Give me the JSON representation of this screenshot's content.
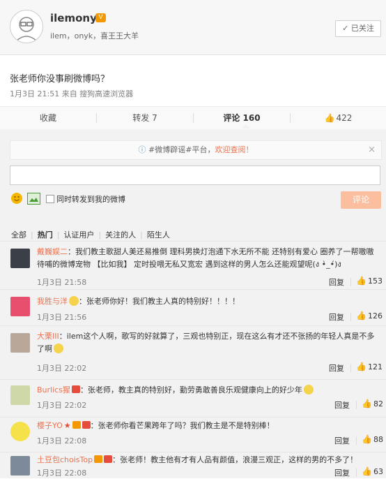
{
  "profile": {
    "username": "ilemonyk",
    "subtitle": "ilem，onyk，喜王王大羊",
    "follow_label": "已关注"
  },
  "post": {
    "text": "张老师你没事刷微博吗？",
    "meta": "1月3日 21:51 来自 搜狗高速浏览器"
  },
  "tabs": {
    "favorite": "收藏",
    "repost": "转发 7",
    "comment": "评论 160",
    "like": "422"
  },
  "compose": {
    "notice_prefix": "#微博辟谣#平台，",
    "notice_highlight": "欢迎查阅！",
    "notice_close": "×",
    "also_repost": "同时转发到我的微博",
    "submit": "评论"
  },
  "filters": {
    "all": "全部",
    "hot": "热门",
    "verified": "认证用户",
    "following": "关注的人",
    "strangers": "陌生人"
  },
  "comments": [
    {
      "name": "戴巍娱二",
      "text": "：我们教主歌甜人美还易推倒 理科男换灯泡通下水无所不能 还特别有爱心 圈养了一帮嗷嗷待哺的微博宠物 【比如我】 定时投喂无私又宽宏 遇到这样的男人怎么还能观望呢(ง •̀_•́)ง",
      "time": "1月3日 21:58",
      "reply": "回复",
      "likes": "153"
    },
    {
      "name": "我胜与洋",
      "text": "：张老师你好！我们教主人真的特别好！！！！",
      "time": "1月3日 21:56",
      "reply": "回复",
      "likes": "126"
    },
    {
      "name": "大栗III",
      "text": "：ilem这个人啊，歌写的好就算了，三观也特别正，现在这么有才还不张扬的年轻人真是不多了啊",
      "time": "1月3日 22:02",
      "reply": "回复",
      "likes": "121"
    },
    {
      "name": "Burlics猩",
      "text": "：张老师，教主真的特别好，勤劳勇敢善良乐观健康向上的好少年",
      "time": "1月3日 22:02",
      "reply": "回复",
      "likes": "82"
    },
    {
      "name": "樱子YO",
      "text": "：张老师你看芒果跨年了吗？我们教主是不是特别棒！",
      "time": "1月3日 22:08",
      "reply": "回复",
      "likes": "88"
    },
    {
      "name": "土豆包choisTop",
      "text": "：张老师！教主他有才有人品有颜值，浪漫三观正，这样的男的不多了！",
      "time": "1月3日 22:08",
      "reply": "回复",
      "likes": "63"
    }
  ],
  "colors": {
    "accent": "#eb7350",
    "submit_disabled": "#fbbf9f"
  }
}
